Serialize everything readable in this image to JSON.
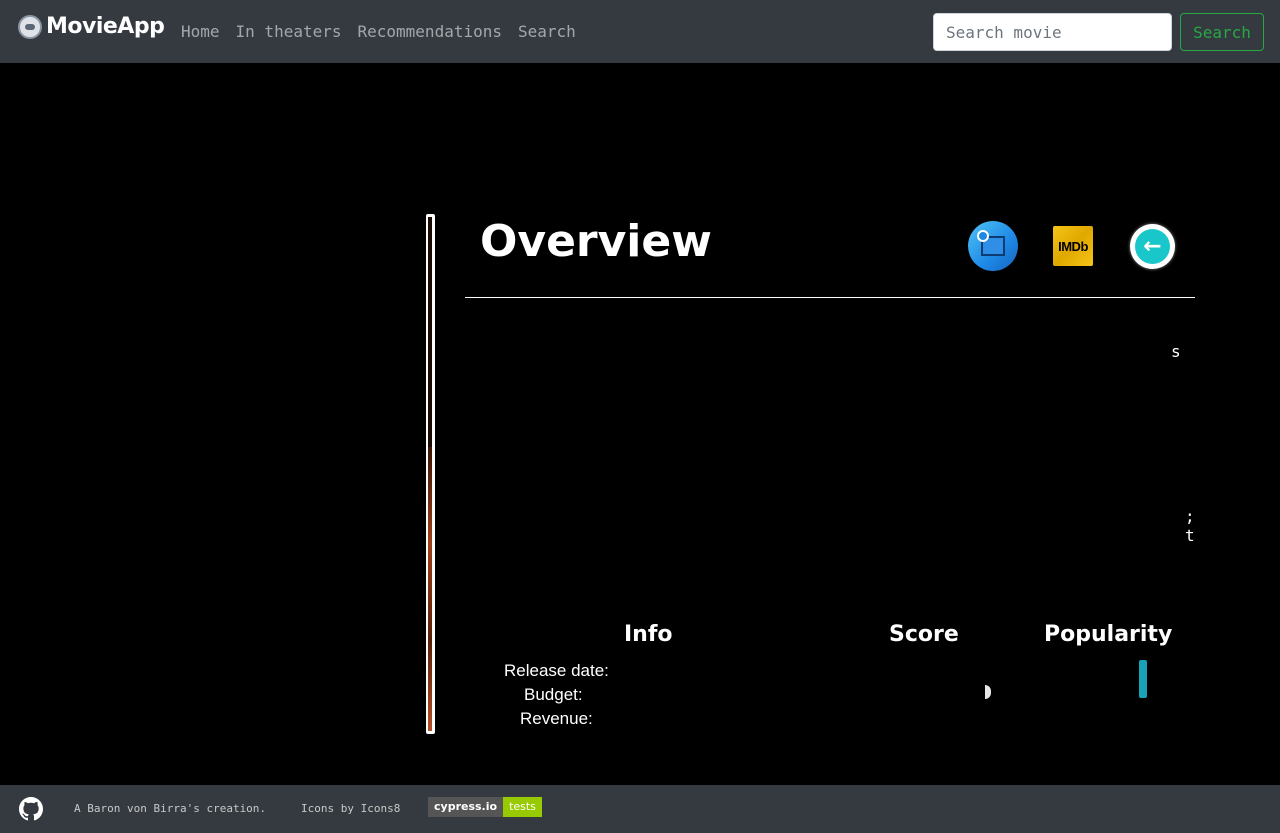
{
  "navbar": {
    "brand": "MovieApp",
    "links": [
      "Home",
      "In theaters",
      "Recommendations",
      "Search"
    ],
    "search_placeholder": "Search movie",
    "search_button": "Search"
  },
  "overview": {
    "title": "Overview",
    "icons": [
      "website-icon",
      "imdb-icon",
      "back-arrow-icon"
    ],
    "imdb_label": "IMDb",
    "back_glyph": "←",
    "fragments": [
      "s",
      ";",
      "t"
    ]
  },
  "stats": {
    "info_title": "Info",
    "score_title": "Score",
    "popularity_title": "Popularity",
    "release_label": "Release date:",
    "budget_label": "Budget:",
    "revenue_label": "Revenue:"
  },
  "footer": {
    "creation": "A Baron von Birra's creation.",
    "icons_credit": "Icons by Icons8",
    "badge_left": "cypress.io",
    "badge_right": "tests"
  },
  "colors": {
    "navbar_bg": "#343a40",
    "search_button": "#28a745",
    "back_icon": "#19c6c9",
    "imdb": "#f5c518",
    "popularity_bar": "#17a2b8",
    "badge_green": "#97ca00"
  }
}
